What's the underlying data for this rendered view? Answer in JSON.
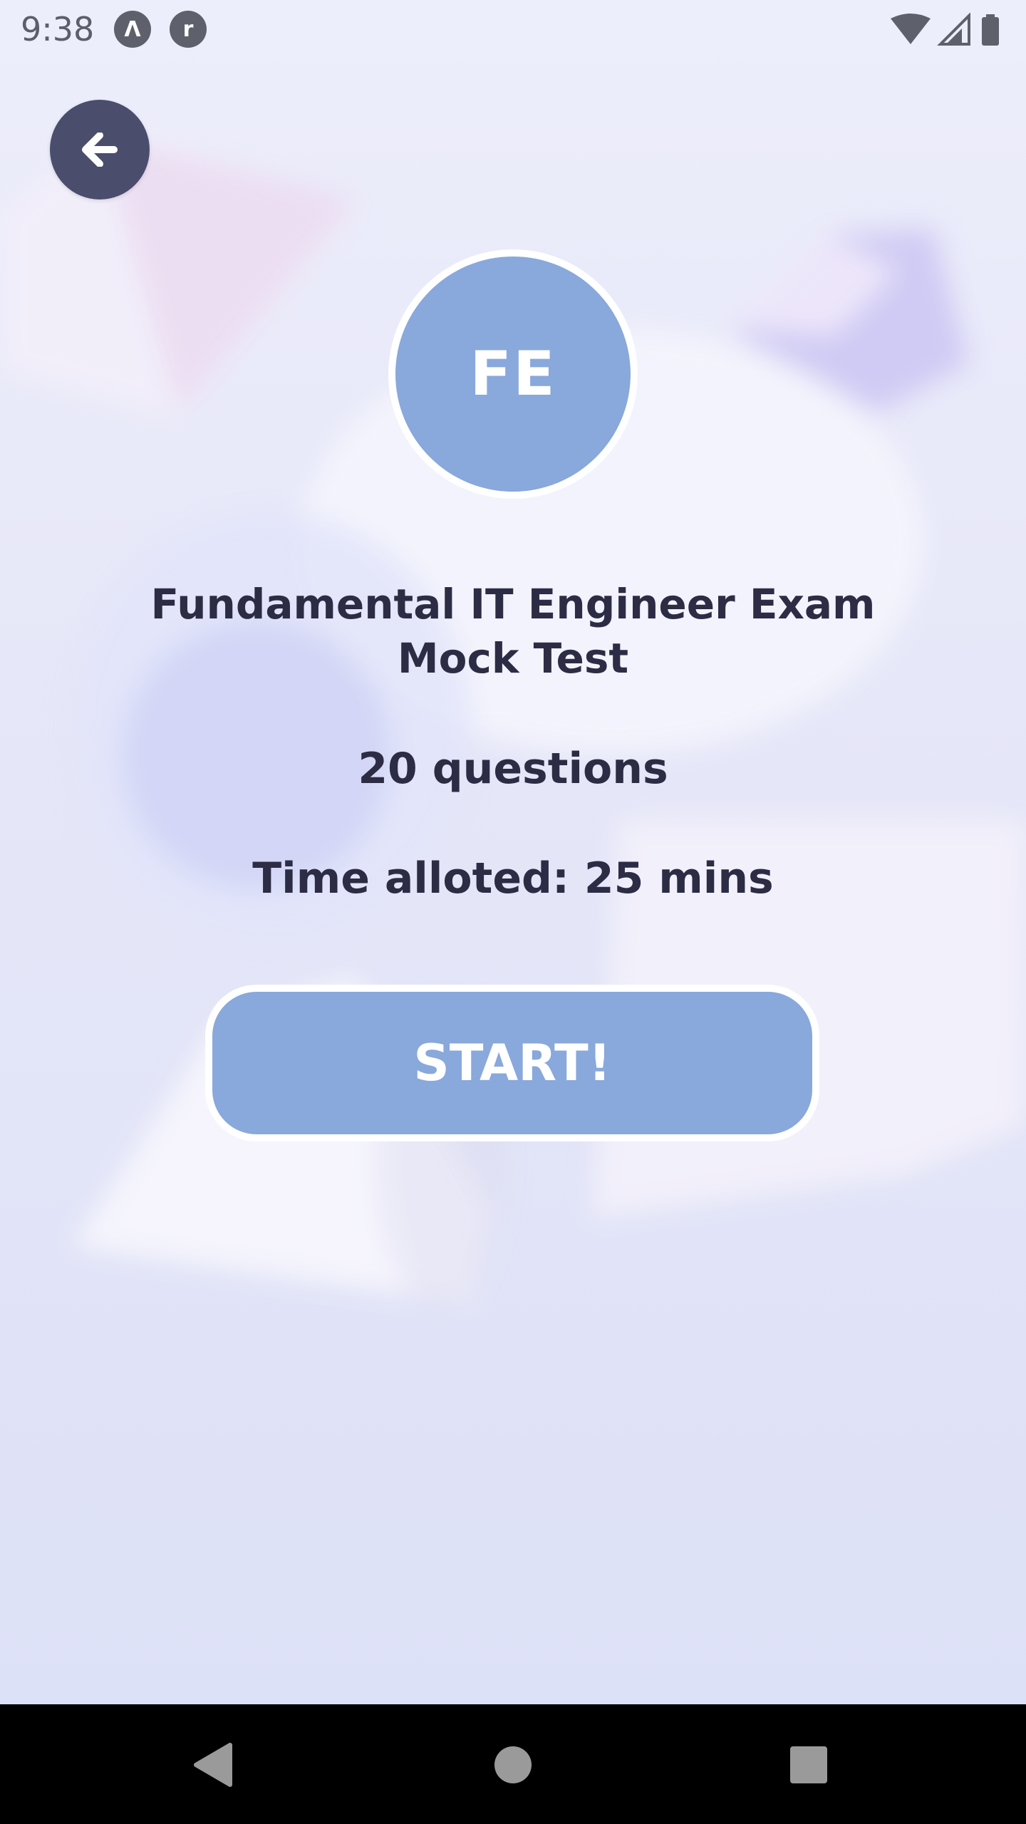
{
  "status_bar": {
    "time": "9:38",
    "app_icon_1": "Λ",
    "app_icon_2": "r",
    "icons": [
      "wifi-icon",
      "cellular-signal-icon",
      "battery-icon"
    ]
  },
  "header": {
    "back_icon": "arrow-left-icon"
  },
  "exam": {
    "avatar_initials": "FE",
    "title": "Fundamental IT Engineer Exam Mock Test",
    "questions": "20 questions",
    "time_allotted": "Time alloted: 25 mins",
    "start_label": "START!"
  },
  "navigation": {
    "icons": [
      "back-triangle-icon",
      "home-circle-icon",
      "recents-square-icon"
    ]
  },
  "colors": {
    "accent": "#89a8db",
    "back_button": "#4b4d6d",
    "text": "#2c2c45",
    "background": "#e4e6f7"
  }
}
